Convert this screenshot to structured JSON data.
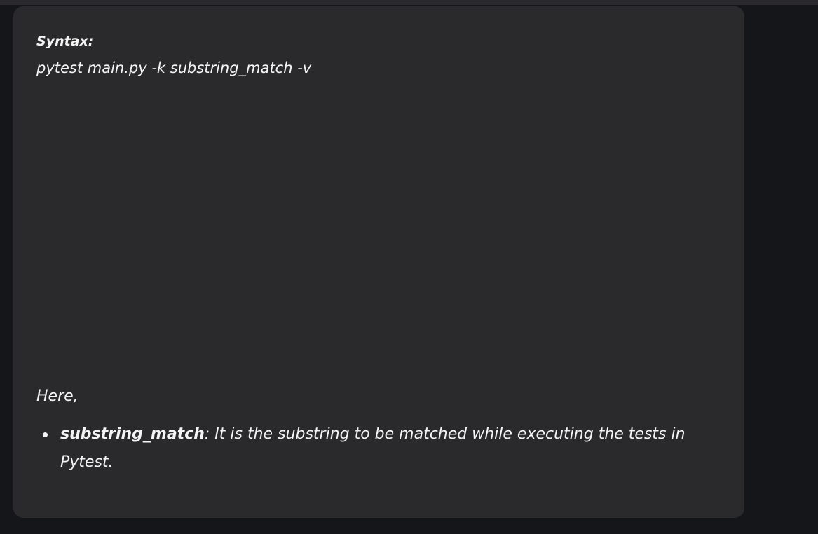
{
  "syntax": {
    "label": "Syntax:",
    "command": "pytest main.py -k substring_match -v"
  },
  "explanation": {
    "intro": "Here,",
    "items": [
      {
        "term": "substring_match",
        "description": ": It is the substring to be matched while executing the tests in Pytest."
      }
    ]
  }
}
